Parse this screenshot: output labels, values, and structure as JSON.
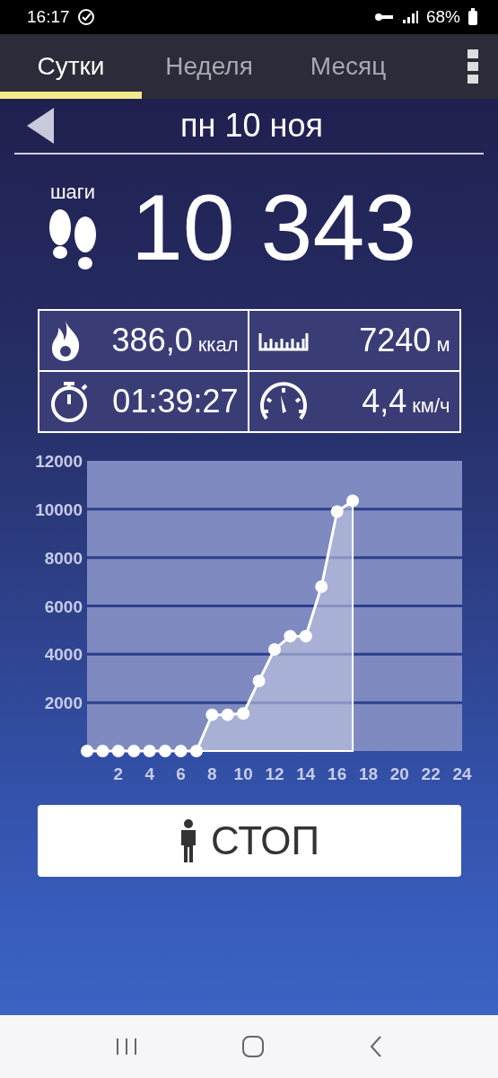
{
  "status_bar": {
    "time": "16:17",
    "battery": "68%"
  },
  "tabs": [
    {
      "label": "Сутки",
      "selected": true
    },
    {
      "label": "Неделя",
      "selected": false
    },
    {
      "label": "Месяц",
      "selected": false
    }
  ],
  "date": "пн 10 ноя",
  "steps": {
    "label": "шаги",
    "value": "10 343"
  },
  "stats": [
    {
      "kind": "calories",
      "value": "386,0",
      "unit": "ккал"
    },
    {
      "kind": "distance",
      "value": "7240",
      "unit": "м"
    },
    {
      "kind": "time",
      "value": "01:39:27"
    },
    {
      "kind": "speed",
      "value": "4,4",
      "unit": "км/ч"
    }
  ],
  "chart": {
    "chart_data": {
      "type": "area",
      "x": [
        0,
        1,
        2,
        3,
        4,
        5,
        6,
        7,
        8,
        9,
        10,
        11,
        12,
        13,
        14,
        15,
        16,
        17
      ],
      "grid": true,
      "series": [
        {
          "color": "#ffffff",
          "values": [
            0,
            0,
            0,
            0,
            0,
            0,
            0,
            0,
            1500,
            1500,
            1550,
            2900,
            4200,
            4750,
            4750,
            6800,
            9900,
            10350
          ]
        }
      ],
      "xlim": [
        0,
        24
      ],
      "ylim": [
        0,
        12000
      ],
      "xticks": [
        2,
        4,
        6,
        8,
        10,
        12,
        14,
        16,
        18,
        20,
        22,
        24
      ],
      "yticks": [
        2000,
        4000,
        6000,
        8000,
        10000,
        12000
      ]
    }
  },
  "button": {
    "label": "СТОП"
  }
}
